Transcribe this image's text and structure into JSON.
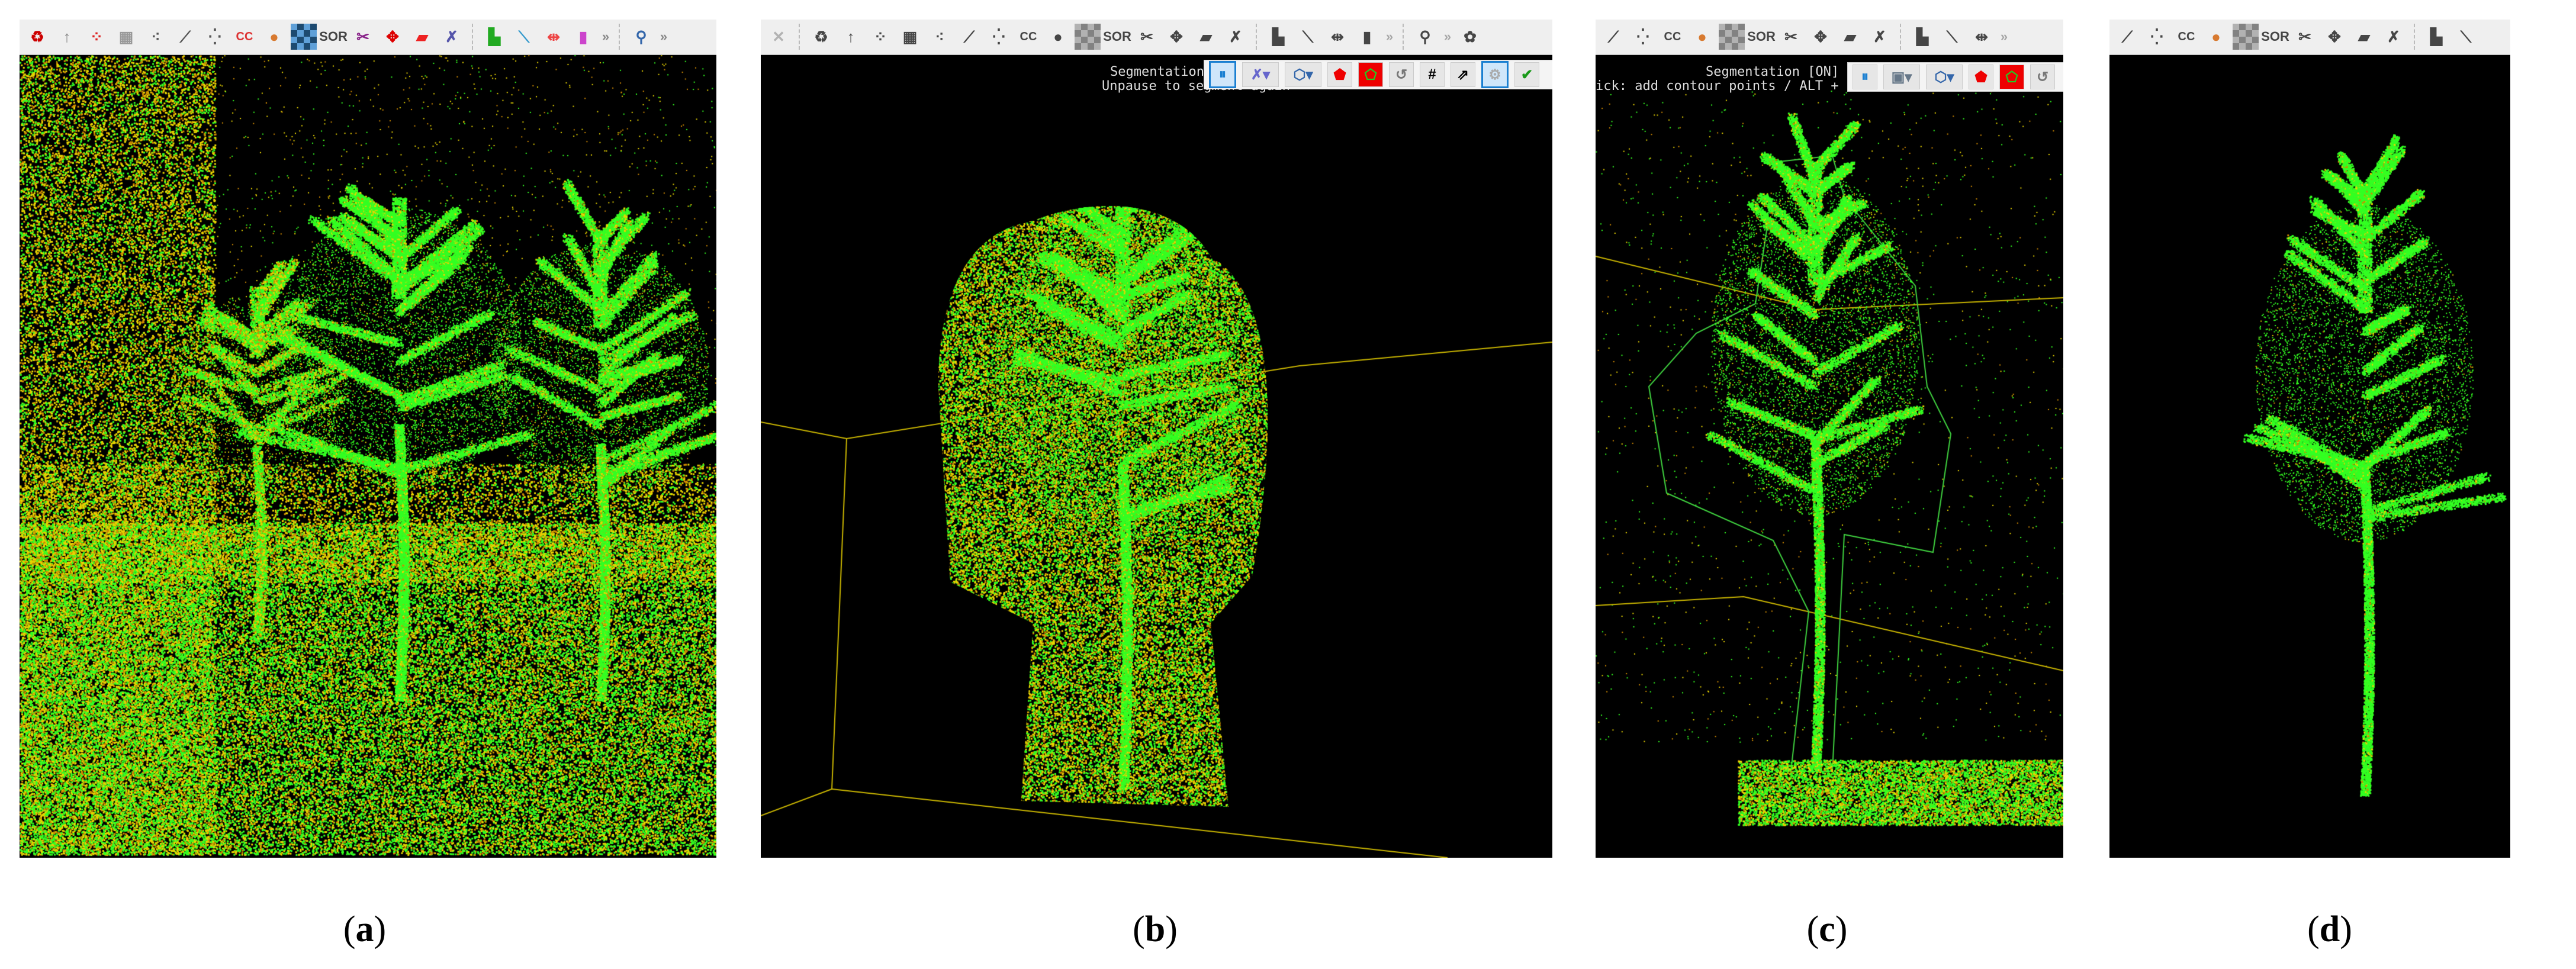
{
  "panels": [
    {
      "id": "a",
      "caption_open": "(",
      "caption_letter": "a",
      "caption_close": ")"
    },
    {
      "id": "b",
      "caption_open": "(",
      "caption_letter": "b",
      "caption_close": ")",
      "overlay_title": "Segmentation",
      "overlay_hint": "Unpause to segment again"
    },
    {
      "id": "c",
      "caption_open": "(",
      "caption_letter": "c",
      "caption_close": ")",
      "overlay_title": "Segmentation [ON] (po",
      "overlay_hint": "ick: add contour points / ALT + left click: remove last / Right c"
    },
    {
      "id": "d",
      "caption_open": "(",
      "caption_letter": "d",
      "caption_close": ")"
    }
  ],
  "toolbar": {
    "sor_label": "SOR",
    "cc_label": "CC",
    "more": "»",
    "hash": "#"
  },
  "colors": {
    "point_green": "#33ff22",
    "point_yellow": "#e8d400",
    "point_orange": "#d08a00",
    "box_line": "#c8b400",
    "contour": "#3fd13f",
    "active_blue": "#1a7fd1"
  }
}
